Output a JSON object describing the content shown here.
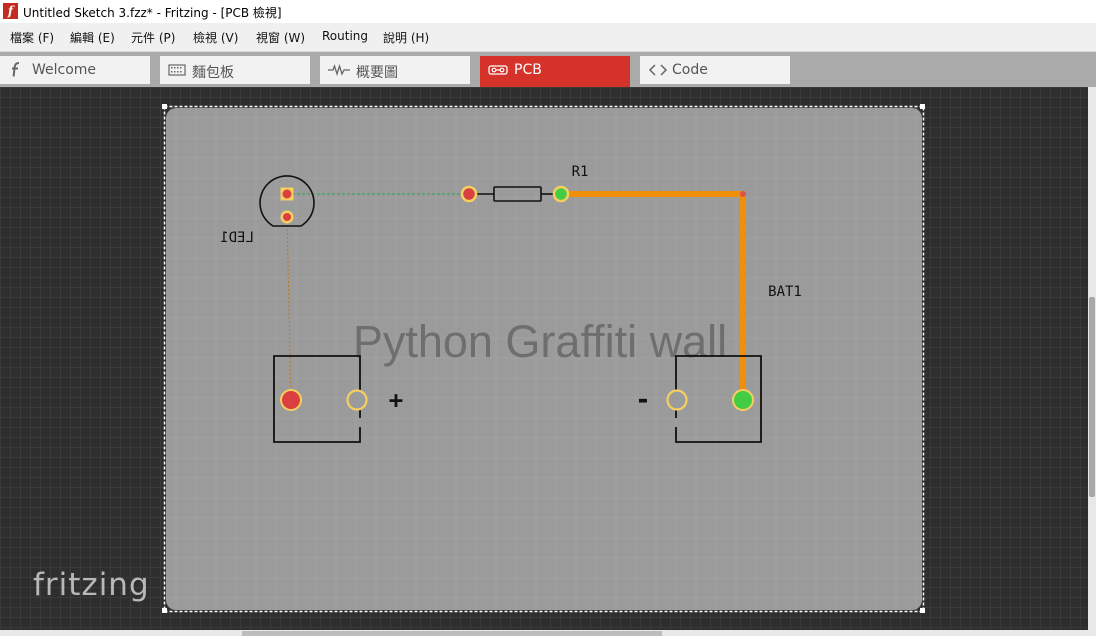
{
  "window": {
    "app_icon_glyph": "f",
    "title": "Untitled Sketch 3.fzz* - Fritzing - [PCB 檢視]"
  },
  "menu": {
    "items": [
      {
        "label": "檔案 (F)"
      },
      {
        "label": "編輯 (E)"
      },
      {
        "label": "元件 (P)"
      },
      {
        "label": "檢視 (V)"
      },
      {
        "label": "視窗 (W)"
      },
      {
        "label": "Routing"
      },
      {
        "label": "說明 (H)"
      }
    ]
  },
  "tabs": [
    {
      "label": "Welcome",
      "icon": "fritzing-f-icon"
    },
    {
      "label": "麵包板",
      "icon": "breadboard-icon"
    },
    {
      "label": "概要圖",
      "icon": "schematic-icon"
    },
    {
      "label": "PCB",
      "icon": "pcb-icon",
      "active": true
    },
    {
      "label": "Code",
      "icon": "code-icon"
    }
  ],
  "pcb": {
    "graffiti_text": "Python Graffiti wall",
    "labels": {
      "led": "LED1",
      "resistor": "R1",
      "battery": "BAT1",
      "plus": "+",
      "minus": "-"
    }
  },
  "watermark": "fritzing",
  "colors": {
    "active_tab": "#d5332a",
    "trace_orange": "#f0900a",
    "ratsnest_green": "#2aa84a",
    "pad_red": "#d94040",
    "pad_yellow": "#f5d060",
    "pad_green": "#44cc44",
    "board_gray": "#9b9b9b"
  }
}
